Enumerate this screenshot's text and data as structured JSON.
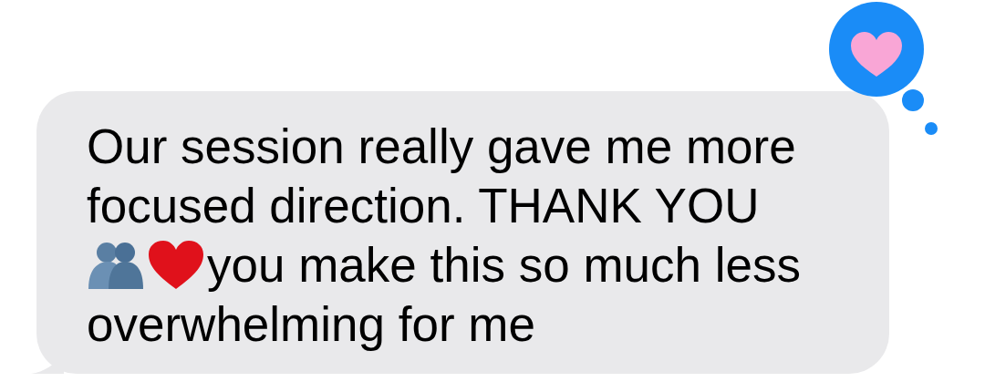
{
  "message": {
    "lines": [
      {
        "text": "Our session really gave me more"
      },
      {
        "text": "focused direction. THANK YOU"
      },
      {
        "emoji": [
          {
            "kind": "hug"
          },
          {
            "kind": "heart"
          }
        ],
        "text": "you make this so much less"
      },
      {
        "text": "overwhelming for me"
      }
    ],
    "reaction": {
      "kind": "heart"
    }
  }
}
